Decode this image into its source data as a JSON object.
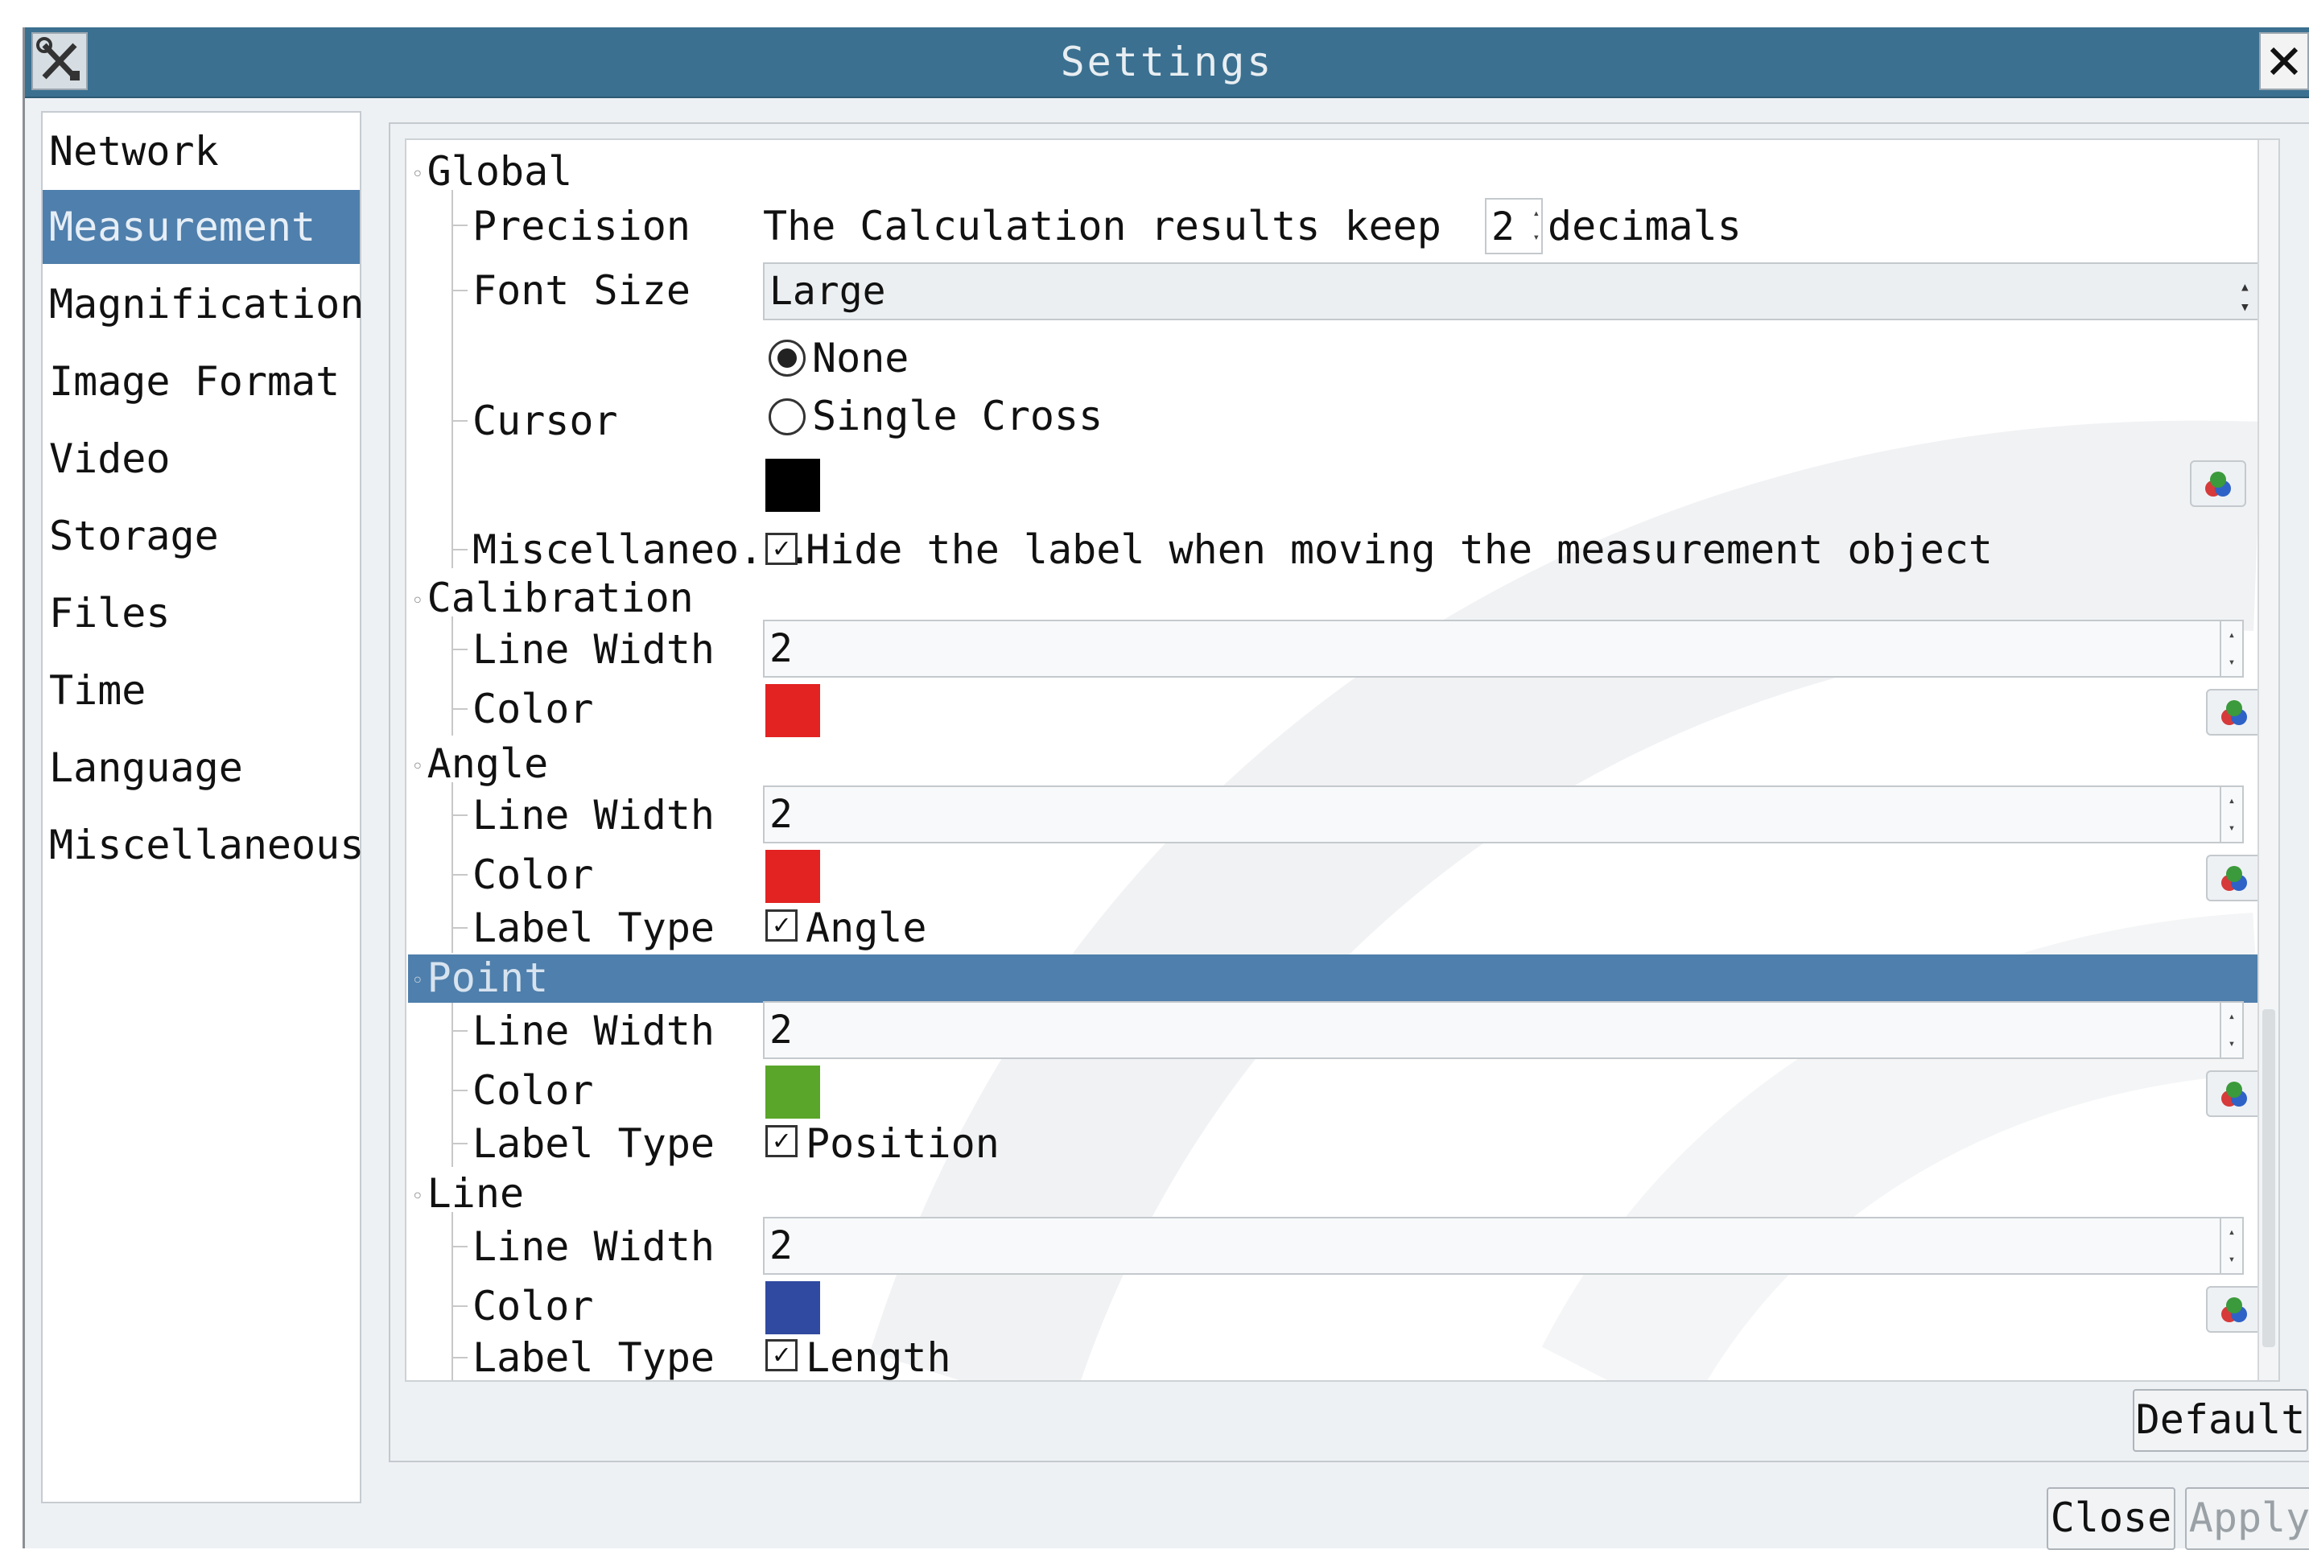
{
  "window": {
    "title": "Settings"
  },
  "nav": {
    "items": [
      "Network",
      "Measurement",
      "Magnification",
      "Image Format",
      "Video",
      "Storage",
      "Files",
      "Time",
      "Language",
      "Miscellaneous"
    ],
    "active": "Measurement"
  },
  "global": {
    "header": "Global",
    "precision_label": "Precision",
    "precision_text": "The Calculation results keep",
    "precision_value": "2",
    "precision_suffix": "decimals",
    "font_size_label": "Font Size",
    "font_size_value": "Large",
    "cursor_label": "Cursor",
    "cursor_option_none": "None",
    "cursor_option_cross": "Single Cross",
    "cursor_color": "#000000",
    "misc_label": "Miscellaneo...",
    "misc_check": "Hide the label when moving the measurement object"
  },
  "calibration": {
    "header": "Calibration",
    "line_width_label": "Line Width",
    "line_width": "2",
    "color_label": "Color",
    "color": "#e32222"
  },
  "angle": {
    "header": "Angle",
    "line_width_label": "Line Width",
    "line_width": "2",
    "color_label": "Color",
    "color": "#e32222",
    "label_type_label": "Label Type",
    "label_type": "Angle"
  },
  "point": {
    "header": "Point",
    "line_width_label": "Line Width",
    "line_width": "2",
    "color_label": "Color",
    "color": "#5aa62a",
    "label_type_label": "Label Type",
    "label_type": "Position"
  },
  "line": {
    "header": "Line",
    "line_width_label": "Line Width",
    "line_width": "2",
    "color_label": "Color",
    "color": "#2f4aa0",
    "label_type_label": "Label Type",
    "label_type": "Length"
  },
  "buttons": {
    "default": "Default",
    "close": "Close",
    "apply": "Apply"
  }
}
